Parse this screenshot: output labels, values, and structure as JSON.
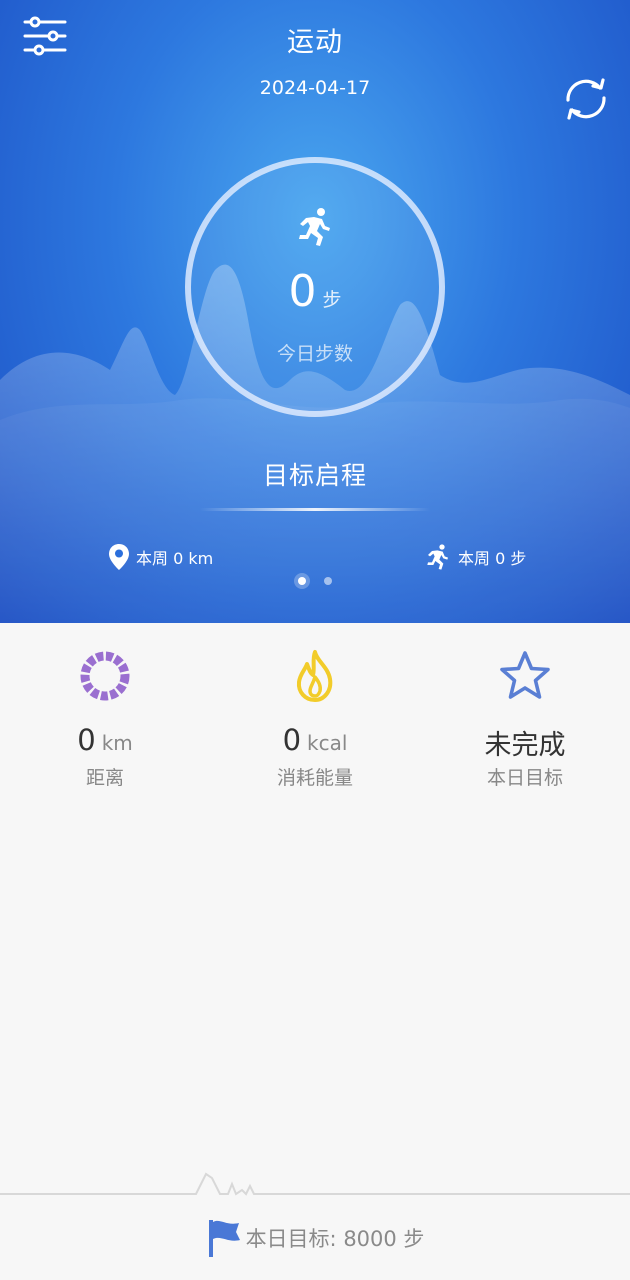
{
  "header": {
    "title": "运动",
    "date": "2024-04-17"
  },
  "today": {
    "steps_value": "0",
    "steps_unit": "步",
    "caption": "今日步数"
  },
  "goal_start_label": "目标启程",
  "weekly": {
    "distance_label": "本周 0 km",
    "steps_label": "本周 0 步"
  },
  "pager": {
    "pages": 2,
    "active_index": 0
  },
  "stats": {
    "distance": {
      "value": "0",
      "unit": "km",
      "label": "距离",
      "icon": "progress-ring-icon",
      "color": "#9a6fd0"
    },
    "calories": {
      "value": "0",
      "unit": "kcal",
      "label": "消耗能量",
      "icon": "flame-icon",
      "color": "#f2cc2a"
    },
    "daily_goal": {
      "status": "未完成",
      "label": "本日目标",
      "icon": "star-icon",
      "color": "#5a7fd4"
    }
  },
  "footer": {
    "goal_text": "本日目标: 8000 步",
    "icon": "flag-icon",
    "accent": "#4a78d6"
  },
  "colors": {
    "hero_dark": "#1c4fc4",
    "hero_light": "#4aa6ef",
    "background": "#f7f7f7"
  }
}
